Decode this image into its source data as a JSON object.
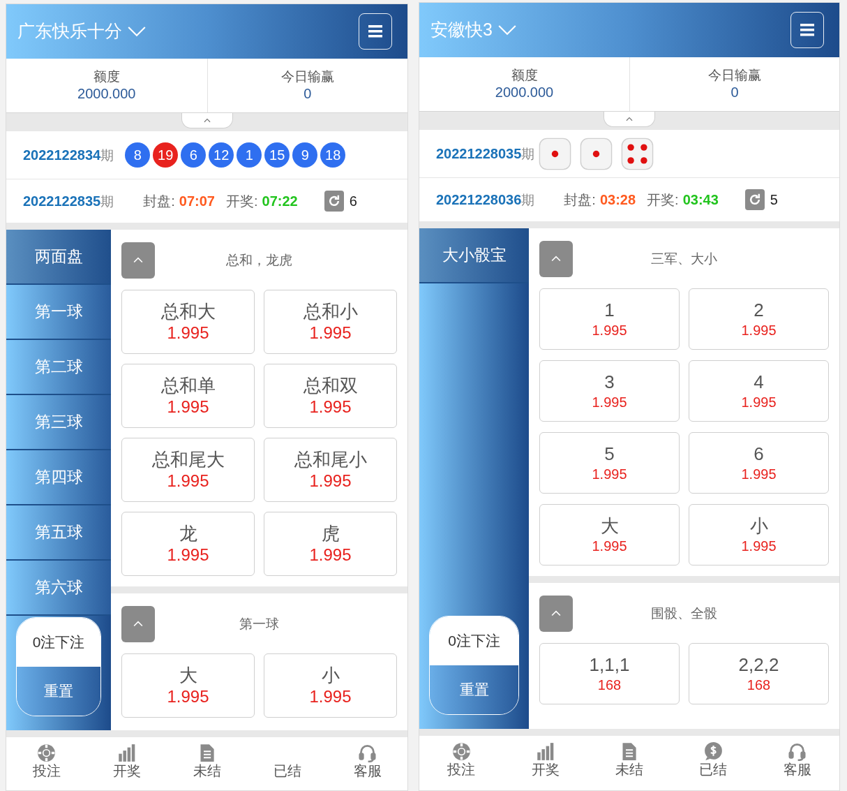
{
  "phones": [
    {
      "game_title": "广东快乐十分",
      "stats": [
        {
          "label": "额度",
          "value": "2000.000"
        },
        {
          "label": "今日输赢",
          "value": "0"
        }
      ],
      "last_draw": {
        "period": "2022122834",
        "suffix": "期",
        "kind": "balls",
        "balls": [
          {
            "number": "8",
            "color": "#2f6ff0"
          },
          {
            "number": "19",
            "color": "#e8221e"
          },
          {
            "number": "6",
            "color": "#2f6ff0"
          },
          {
            "number": "12",
            "color": "#2f6ff0"
          },
          {
            "number": "1",
            "color": "#2f6ff0"
          },
          {
            "number": "15",
            "color": "#2f6ff0"
          },
          {
            "number": "9",
            "color": "#2f6ff0"
          },
          {
            "number": "18",
            "color": "#2f6ff0"
          }
        ]
      },
      "next_draw": {
        "period": "2022122835",
        "suffix": "期",
        "close_label": "封盘:",
        "close_time": "07:07",
        "draw_label": "开奖:",
        "draw_time": "07:22",
        "count": "6"
      },
      "sidebar": [
        {
          "label": "两面盘",
          "selected": true
        },
        {
          "label": "第一球",
          "selected": false
        },
        {
          "label": "第二球",
          "selected": false
        },
        {
          "label": "第三球",
          "selected": false
        },
        {
          "label": "第四球",
          "selected": false
        },
        {
          "label": "第五球",
          "selected": false
        },
        {
          "label": "第六球",
          "selected": false
        }
      ],
      "bet_button": "0注下注",
      "reset_button": "重置",
      "sections": [
        {
          "title": "总和，龙虎",
          "options": [
            {
              "name": "总和大",
              "odds": "1.995"
            },
            {
              "name": "总和小",
              "odds": "1.995"
            },
            {
              "name": "总和单",
              "odds": "1.995"
            },
            {
              "name": "总和双",
              "odds": "1.995"
            },
            {
              "name": "总和尾大",
              "odds": "1.995"
            },
            {
              "name": "总和尾小",
              "odds": "1.995"
            },
            {
              "name": "龙",
              "odds": "1.995"
            },
            {
              "name": "虎",
              "odds": "1.995"
            }
          ]
        },
        {
          "title": "第一球",
          "options": [
            {
              "name": "大",
              "odds": "1.995"
            },
            {
              "name": "小",
              "odds": "1.995"
            }
          ]
        }
      ],
      "nav": [
        {
          "label": "投注",
          "kind": "chip"
        },
        {
          "label": "开奖",
          "kind": "chart"
        },
        {
          "label": "未结",
          "kind": "doc"
        },
        {
          "label": "已结",
          "kind": "none"
        },
        {
          "label": "客服",
          "kind": "headset"
        }
      ]
    },
    {
      "game_title": "安徽快3",
      "stats": [
        {
          "label": "额度",
          "value": "2000.000"
        },
        {
          "label": "今日输赢",
          "value": "0"
        }
      ],
      "last_draw": {
        "period": "20221228035",
        "suffix": "期",
        "kind": "dice",
        "dice": [
          {
            "kind": "one"
          },
          {
            "kind": "one"
          },
          {
            "kind": "four"
          }
        ]
      },
      "next_draw": {
        "period": "20221228036",
        "suffix": "期",
        "close_label": "封盘:",
        "close_time": "03:28",
        "draw_label": "开奖:",
        "draw_time": "03:43",
        "count": "5"
      },
      "sidebar": [
        {
          "label": "大小骰宝",
          "selected": true
        }
      ],
      "bet_button": "0注下注",
      "reset_button": "重置",
      "sections": [
        {
          "title": "三军、大小",
          "options": [
            {
              "name": "1",
              "odds": "1.995"
            },
            {
              "name": "2",
              "odds": "1.995"
            },
            {
              "name": "3",
              "odds": "1.995"
            },
            {
              "name": "4",
              "odds": "1.995"
            },
            {
              "name": "5",
              "odds": "1.995"
            },
            {
              "name": "6",
              "odds": "1.995"
            },
            {
              "name": "大",
              "odds": "1.995"
            },
            {
              "name": "小",
              "odds": "1.995"
            }
          ]
        },
        {
          "title": "围骰、全骰",
          "options": [
            {
              "name": "1,1,1",
              "odds": "168"
            },
            {
              "name": "2,2,2",
              "odds": "168"
            }
          ]
        }
      ],
      "nav": [
        {
          "label": "投注",
          "kind": "chip"
        },
        {
          "label": "开奖",
          "kind": "chart"
        },
        {
          "label": "未结",
          "kind": "doc"
        },
        {
          "label": "已结",
          "kind": "dollar"
        },
        {
          "label": "客服",
          "kind": "headset"
        }
      ]
    }
  ]
}
